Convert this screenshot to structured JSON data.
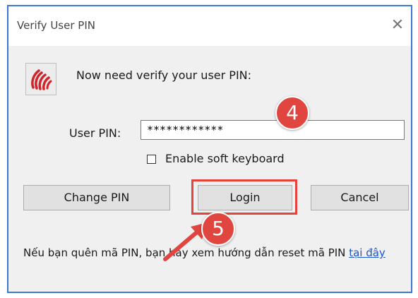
{
  "window": {
    "title": "Verify User PIN",
    "close_glyph": "✕"
  },
  "icons": {
    "app": "hand-print-icon",
    "close": "close-icon",
    "arrow": "arrow-icon"
  },
  "message": "Now need verify your user PIN:",
  "pin": {
    "label": "User PIN:",
    "value": "************"
  },
  "soft_keyboard": {
    "label": "Enable soft keyboard",
    "checked": false
  },
  "buttons": {
    "change_pin": "Change PIN",
    "login": "Login",
    "cancel": "Cancel"
  },
  "annotations": {
    "step4": "4",
    "step5": "5",
    "color": "#e0463f"
  },
  "help": {
    "text": "Nếu bạn quên mã PIN, bạn hãy xem hướng dẫn reset mã PIN",
    "link": "tại đây"
  }
}
